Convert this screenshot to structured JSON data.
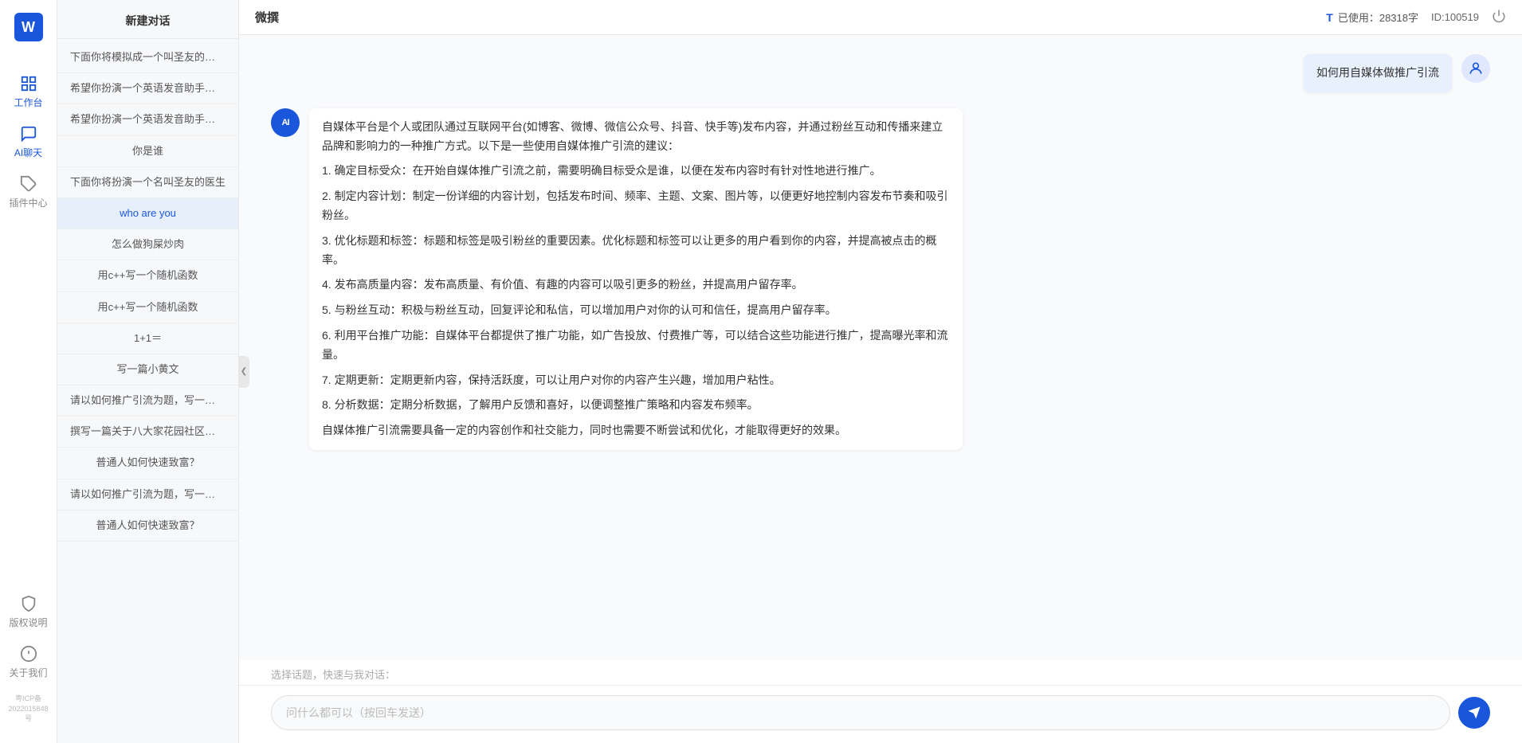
{
  "app": {
    "title": "微撰",
    "logo_letter": "W",
    "logo_label": "微撰"
  },
  "topbar": {
    "usage_icon": "T",
    "usage_label": "已使用：28318字",
    "id_label": "ID:100519"
  },
  "nav": {
    "items": [
      {
        "id": "workbench",
        "label": "工作台",
        "icon": "grid"
      },
      {
        "id": "ai-chat",
        "label": "AI聊天",
        "icon": "chat",
        "active": true
      },
      {
        "id": "plugin",
        "label": "插件中心",
        "icon": "plugin"
      }
    ],
    "bottom": [
      {
        "id": "copyright",
        "label": "版权说明",
        "icon": "shield"
      },
      {
        "id": "about",
        "label": "关于我们",
        "icon": "info"
      }
    ],
    "icp": "粤ICP备2022015848号"
  },
  "sidebar": {
    "new_chat": "新建对话",
    "items": [
      {
        "id": 1,
        "text": "下面你将模拟成一个叫圣友的程序员，我说...",
        "active": false
      },
      {
        "id": 2,
        "text": "希望你扮演一个英语发音助手，我提供给你...",
        "active": false
      },
      {
        "id": 3,
        "text": "希望你扮演一个英语发音助手，我提供给你...",
        "active": false
      },
      {
        "id": 4,
        "text": "你是谁",
        "active": false
      },
      {
        "id": 5,
        "text": "下面你将扮演一个名叫圣友的医生",
        "active": false
      },
      {
        "id": 6,
        "text": "who are you",
        "active": true
      },
      {
        "id": 7,
        "text": "怎么做狗屎炒肉",
        "active": false
      },
      {
        "id": 8,
        "text": "用c++写一个随机函数",
        "active": false
      },
      {
        "id": 9,
        "text": "用c++写一个随机函数",
        "active": false
      },
      {
        "id": 10,
        "text": "1+1＝",
        "active": false
      },
      {
        "id": 11,
        "text": "写一篇小黄文",
        "active": false
      },
      {
        "id": 12,
        "text": "请以如何推广引流为题，写一篇大纲",
        "active": false
      },
      {
        "id": 13,
        "text": "撰写一篇关于八大家花园社区一刻钟便民生...",
        "active": false
      },
      {
        "id": 14,
        "text": "普通人如何快速致富？",
        "active": false
      },
      {
        "id": 15,
        "text": "请以如何推广引流为题，写一篇大纲",
        "active": false
      },
      {
        "id": 16,
        "text": "普通人如何快速致富？",
        "active": false
      }
    ]
  },
  "chat": {
    "messages": [
      {
        "id": 1,
        "role": "user",
        "avatar_type": "user",
        "text": "如何用自媒体做推广引流"
      },
      {
        "id": 2,
        "role": "ai",
        "avatar_type": "ai",
        "avatar_label": "AI",
        "paragraphs": [
          "自媒体平台是个人或团队通过互联网平台(如博客、微博、微信公众号、抖音、快手等)发布内容，并通过粉丝互动和传播来建立品牌和影响力的一种推广方式。以下是一些使用自媒体推广引流的建议：",
          "1. 确定目标受众：在开始自媒体推广引流之前，需要明确目标受众是谁，以便在发布内容时有针对性地进行推广。",
          "2. 制定内容计划：制定一份详细的内容计划，包括发布时间、频率、主题、文案、图片等，以便更好地控制内容发布节奏和吸引粉丝。",
          "3. 优化标题和标签：标题和标签是吸引粉丝的重要因素。优化标题和标签可以让更多的用户看到你的内容，并提高被点击的概率。",
          "4. 发布高质量内容：发布高质量、有价值、有趣的内容可以吸引更多的粉丝，并提高用户留存率。",
          "5. 与粉丝互动：积极与粉丝互动，回复评论和私信，可以增加用户对你的认可和信任，提高用户留存率。",
          "6. 利用平台推广功能：自媒体平台都提供了推广功能，如广告投放、付费推广等，可以结合这些功能进行推广，提高曝光率和流量。",
          "7. 定期更新：定期更新内容，保持活跃度，可以让用户对你的内容产生兴趣，增加用户粘性。",
          "8. 分析数据：定期分析数据，了解用户反馈和喜好，以便调整推广策略和内容发布频率。",
          "自媒体推广引流需要具备一定的内容创作和社交能力，同时也需要不断尝试和优化，才能取得更好的效果。"
        ]
      }
    ],
    "quick_topic_label": "选择话题，快速与我对话：",
    "input_placeholder": "问什么都可以（按回车发送）"
  }
}
